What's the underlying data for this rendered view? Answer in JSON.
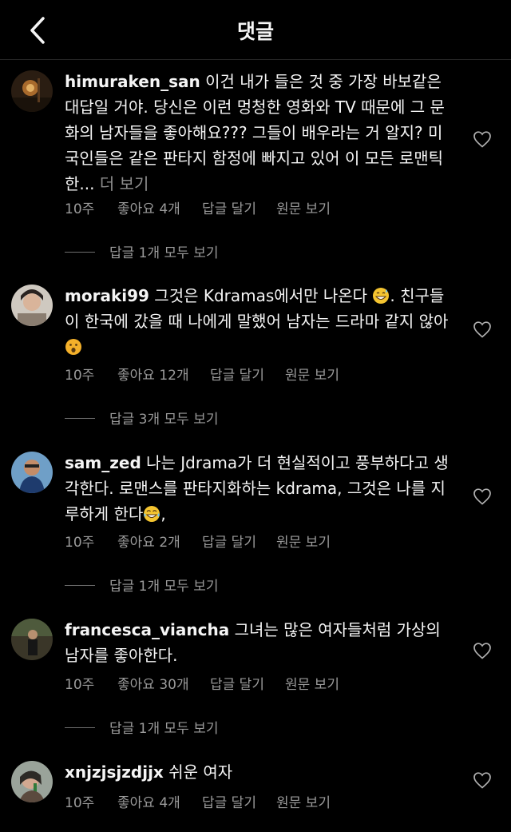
{
  "header": {
    "title": "댓글",
    "back_icon": "chevron-left-icon"
  },
  "colors": {
    "background": "#000000",
    "text": "#f5f5f5",
    "secondary_text": "#9a9a9a",
    "divider": "#262626"
  },
  "comments": [
    {
      "username": "himuraken_san",
      "text": "이건 내가 들은 것 중 가장 바보같은 대답일 거야. 당신은 이런 멍청한 영화와 TV 때문에 그 문화의 남자들을 좋아해요??? 그들이 배우라는 거 알지? 미국인들은 같은 판타지 함정에 빠지고 있어 이 모든 로맨틱한... ",
      "more_label": "더 보기",
      "time": "10주",
      "likes": "좋아요 4개",
      "reply": "답글 달기",
      "original": "원문 보기",
      "replies": "답글 1개 모두 보기"
    },
    {
      "username": "moraki99",
      "text_a": "그것은 Kdramas에서만 나온다",
      "emoji_a": "grinning-sweat-emoji",
      "text_b": ". 친구들이 한국에 갔을 때 나에게 말했어 남자는 드라마 같지 않아",
      "emoji_b": "surprised-face-emoji",
      "time": "10주",
      "likes": "좋아요 12개",
      "reply": "답글 달기",
      "original": "원문 보기",
      "replies": "답글 3개 모두 보기"
    },
    {
      "username": "sam_zed",
      "text_a": "나는 Jdrama가 더 현실적이고 풍부하다고 생각한다. 로맨스를 판타지화하는 kdrama, 그것은 나를 지루하게 한다",
      "emoji_a": "tears-of-joy-emoji",
      "text_b": ",",
      "time": "10주",
      "likes": "좋아요 2개",
      "reply": "답글 달기",
      "original": "원문 보기",
      "replies": "답글 1개 모두 보기"
    },
    {
      "username": "francesca_viancha",
      "text": "그녀는 많은 여자들처럼 가상의 남자를 좋아한다.",
      "time": "10주",
      "likes": "좋아요 30개",
      "reply": "답글 달기",
      "original": "원문 보기",
      "replies": "답글 1개 모두 보기"
    },
    {
      "username": "xnjzjsjzdjjx",
      "text": "쉬운 여자",
      "time": "10주",
      "likes": "좋아요 4개",
      "reply": "답글 달기",
      "original": "원문 보기"
    }
  ]
}
